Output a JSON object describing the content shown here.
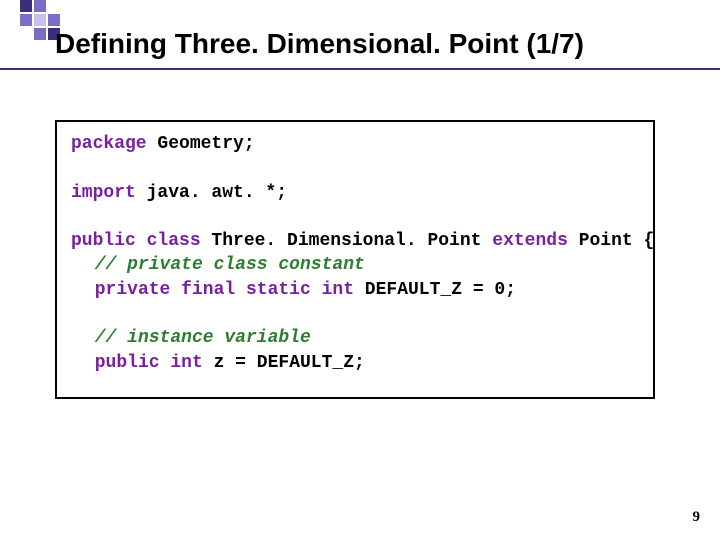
{
  "title": "Defining Three. Dimensional. Point (1/7)",
  "page_number": "9",
  "code": {
    "l1_kw": "package",
    "l1_rest": " Geometry;",
    "l2_kw": "import",
    "l2_rest": " java. awt. *;",
    "l3_kw1": "public class",
    "l3_name": " Three. Dimensional. Point ",
    "l3_kw2": "extends",
    "l3_rest": " Point {",
    "l4_cmt": "// private class constant",
    "l5_kw": "private final static int",
    "l5_rest": " DEFAULT_Z = 0;",
    "l6_cmt": "// instance variable",
    "l7_kw": "public int",
    "l7_rest": " z = DEFAULT_Z;"
  }
}
